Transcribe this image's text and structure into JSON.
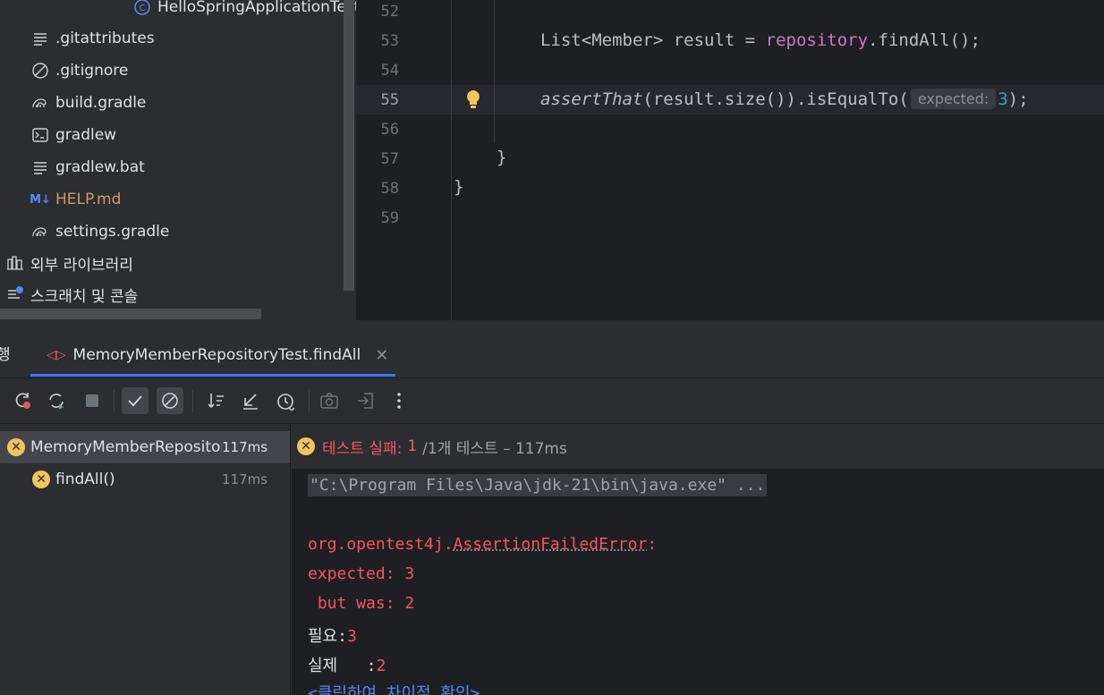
{
  "project_tree": {
    "items": [
      {
        "label": "HelloSpringApplicationTests",
        "icon": "class-icon"
      },
      {
        "label": ".gitattributes",
        "icon": "text-file-icon"
      },
      {
        "label": ".gitignore",
        "icon": "ignore-file-icon"
      },
      {
        "label": "build.gradle",
        "icon": "gradle-icon"
      },
      {
        "label": "gradlew",
        "icon": "terminal-icon"
      },
      {
        "label": "gradlew.bat",
        "icon": "text-file-icon"
      },
      {
        "label": "HELP.md",
        "icon": "markdown-icon"
      },
      {
        "label": "settings.gradle",
        "icon": "gradle-icon"
      },
      {
        "label": "외부 라이브러리",
        "icon": "library-icon"
      },
      {
        "label": "스크래치 및 콘솔",
        "icon": "scratch-icon"
      }
    ],
    "markdown_color": "#d19a66"
  },
  "editor": {
    "line_numbers": [
      "52",
      "53",
      "54",
      "55",
      "56",
      "57",
      "58",
      "59"
    ],
    "line53": {
      "prefix": "List<Member> result = ",
      "field": "repository",
      "suffix": ".findAll();"
    },
    "line55": {
      "method": "assertThat",
      "middle": "(result.size()).isEqualTo(",
      "hint": "expected:",
      "value": "3",
      "end": ");"
    },
    "line57": "}",
    "line58": "}"
  },
  "run_window": {
    "side_label": "행",
    "tab_title": "MemoryMemberRepositoryTest.findAll",
    "test_tree": [
      {
        "label": "MemoryMemberRepositor",
        "time": "117ms"
      },
      {
        "label": "findAll()",
        "time": "117ms"
      }
    ],
    "status": {
      "failed_label": "테스트 실패:",
      "failed_count": "1",
      "rest": "/1개 테스트 – 117ms"
    },
    "console": {
      "command": "\"C:\\Program Files\\Java\\jdk-21\\bin\\java.exe\" ...",
      "error_class_prefix": "org.opentest4j.",
      "error_class": "AssertionFailedError",
      "error_colon": ":",
      "expected_line": "expected: 3",
      "actual_line": " but was: 2",
      "need_label": "필요:",
      "need_value": "3",
      "actual_label": "실제   :",
      "actual_value": "2",
      "diff_link": "<클릭하여 차이점 확인>"
    }
  },
  "colors": {
    "error": "#f75464",
    "fail_icon": "#f2c55c",
    "link": "#548af7"
  }
}
